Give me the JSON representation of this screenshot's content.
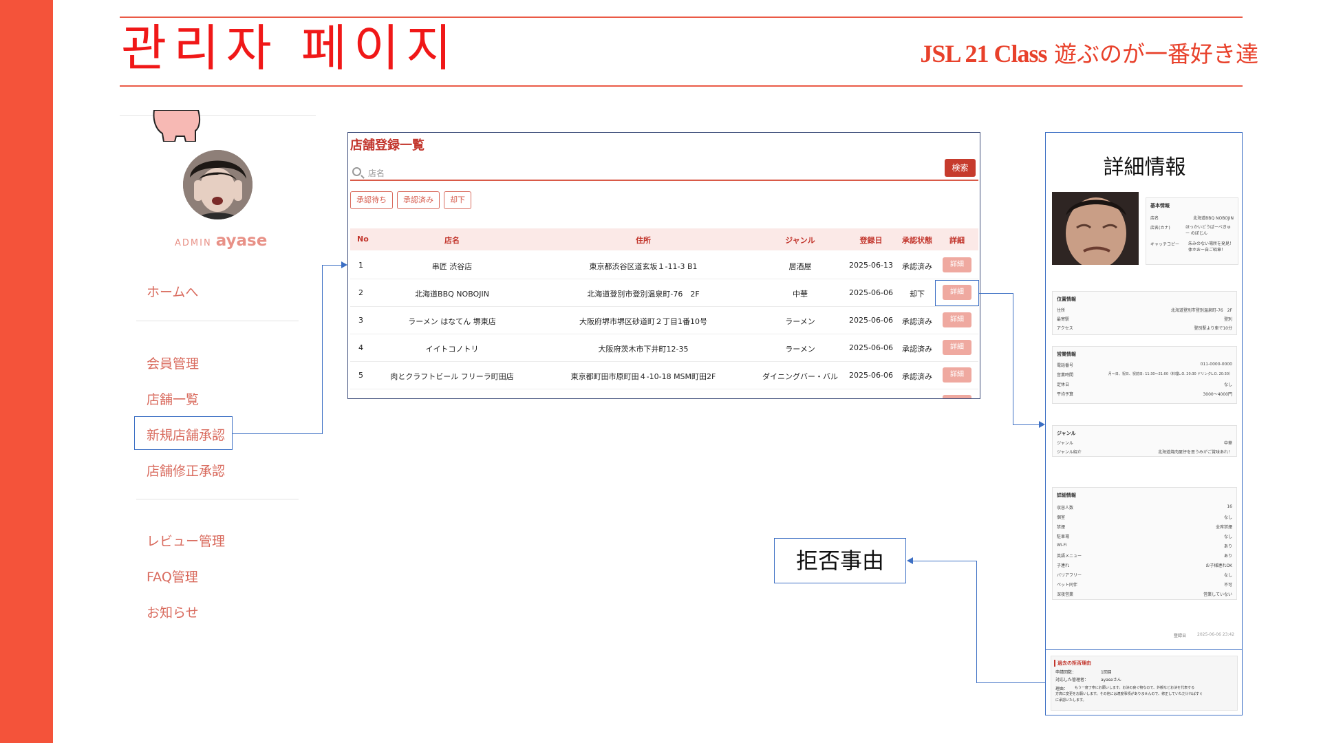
{
  "header": {
    "title": "관리자 페이지",
    "brand_bold": "JSL 21 Class",
    "brand_rest": " 遊ぶのが一番好き達"
  },
  "sidebar": {
    "admin_label": "ADMIN",
    "admin_name": "ayase",
    "nav": [
      {
        "label": "ホームへ"
      },
      {
        "label": "会員管理"
      },
      {
        "label": "店舗一覧"
      },
      {
        "label": "新規店舗承認"
      },
      {
        "label": "店舗修正承認"
      },
      {
        "label": "レビュー管理"
      },
      {
        "label": "FAQ管理"
      },
      {
        "label": "お知らせ"
      }
    ]
  },
  "list": {
    "title": "店舗登録一覧",
    "search_placeholder": "店名",
    "search_button": "検索",
    "filters": [
      "承認待ち",
      "承認済み",
      "却下"
    ],
    "columns": [
      "No",
      "店名",
      "住所",
      "ジャンル",
      "登録日",
      "承認状態",
      "詳細"
    ],
    "rows": [
      {
        "no": "1",
        "name": "串匠 渋谷店",
        "address": "東京都渋谷区道玄坂１-11-3 B1",
        "genre": "居酒屋",
        "date": "2025-06-13",
        "status": "承認済み",
        "detail": "詳細"
      },
      {
        "no": "2",
        "name": "北海道BBQ NOBOJIN",
        "address": "北海道登別市登別温泉町-76　2F",
        "genre": "中華",
        "date": "2025-06-06",
        "status": "却下",
        "detail": "詳細"
      },
      {
        "no": "3",
        "name": "ラーメン はなてん 堺東店",
        "address": "大阪府堺市堺区砂道町２丁目1番10号",
        "genre": "ラーメン",
        "date": "2025-06-06",
        "status": "承認済み",
        "detail": "詳細"
      },
      {
        "no": "4",
        "name": "イイトコノトリ",
        "address": "大阪府茨木市下井町12-35",
        "genre": "ラーメン",
        "date": "2025-06-06",
        "status": "承認済み",
        "detail": "詳細"
      },
      {
        "no": "5",
        "name": "肉とクラフトビール フリーラ町田店",
        "address": "東京都町田市原町田４-10-18 MSM町田2F",
        "genre": "ダイニングバー・バル",
        "date": "2025-06-06",
        "status": "承認済み",
        "detail": "詳細"
      }
    ]
  },
  "detail": {
    "title": "詳細情報",
    "basic": {
      "head": "基本情報",
      "items": [
        {
          "k": "店名",
          "v": "北海道BBQ NOBOJIN"
        },
        {
          "k": "店名(カナ)",
          "v": "ほっかいどうばーべきゅー のぼじん"
        },
        {
          "k": "キャッチコピー",
          "v": "朱みのない場所を発見！体ホおー自ご昭章！"
        }
      ]
    },
    "location": {
      "head": "位置情報",
      "items": [
        {
          "k": "住所",
          "v": "北海道登別市登別温泉町-76　2F"
        },
        {
          "k": "最寄駅",
          "v": "登別"
        },
        {
          "k": "アクセス",
          "v": "登別駅より車で10分"
        }
      ]
    },
    "business": {
      "head": "営業情報",
      "items": [
        {
          "k": "電話番号",
          "v": "011-0000-0000"
        },
        {
          "k": "営業時間",
          "v": "月～日、祝日、祝前日: 11:30～21:00（料理L.O. 20:30 ドリンクL.O. 20:30）"
        },
        {
          "k": "定休日",
          "v": "なし"
        },
        {
          "k": "平均予算",
          "v": "3000～4000円"
        }
      ]
    },
    "genre": {
      "head": "ジャンル",
      "items": [
        {
          "k": "ジャンル",
          "v": "中華"
        },
        {
          "k": "ジャンル紹介",
          "v": "北海道焼肉屋仔を思うみがご賞味あれ！"
        }
      ]
    },
    "extra": {
      "head": "詳細情報",
      "items": [
        {
          "k": "収容人数",
          "v": "16"
        },
        {
          "k": "個室",
          "v": "なし"
        },
        {
          "k": "禁煙",
          "v": "全席禁煙"
        },
        {
          "k": "駐車場",
          "v": "なし"
        },
        {
          "k": "Wi-Fi",
          "v": "あり"
        },
        {
          "k": "英語メニュー",
          "v": "あり"
        },
        {
          "k": "子連れ",
          "v": "お子様連れOK"
        },
        {
          "k": "バリアフリー",
          "v": "なし"
        },
        {
          "k": "ペット同伴",
          "v": "不可"
        },
        {
          "k": "深夜営業",
          "v": "営業していない"
        }
      ]
    },
    "registered_label": "登録日",
    "registered_value": "2025-06-06 23:42"
  },
  "reason": {
    "title": "過去の拒否理由",
    "count_label": "申請回数：",
    "count_value": "1回目",
    "admin_label": "対応した管理者：",
    "admin_value": "ayaseさん",
    "reason_label": "理由：",
    "reason_line1": "もう一度丁寧にお願いします。お決の良ぐ物なので、外観などお決を代表する",
    "reason_line2": "方高に変更をお願いします。その他には適度事項がありませんので、修正していただければすぐ",
    "reason_line3": "に承認いたします。"
  },
  "callout": {
    "label": "拒否事由"
  },
  "colors": {
    "accent": "#f4533a",
    "title_red": "#f01818",
    "brand": "#e8412b",
    "connector": "#3c6fc4"
  }
}
